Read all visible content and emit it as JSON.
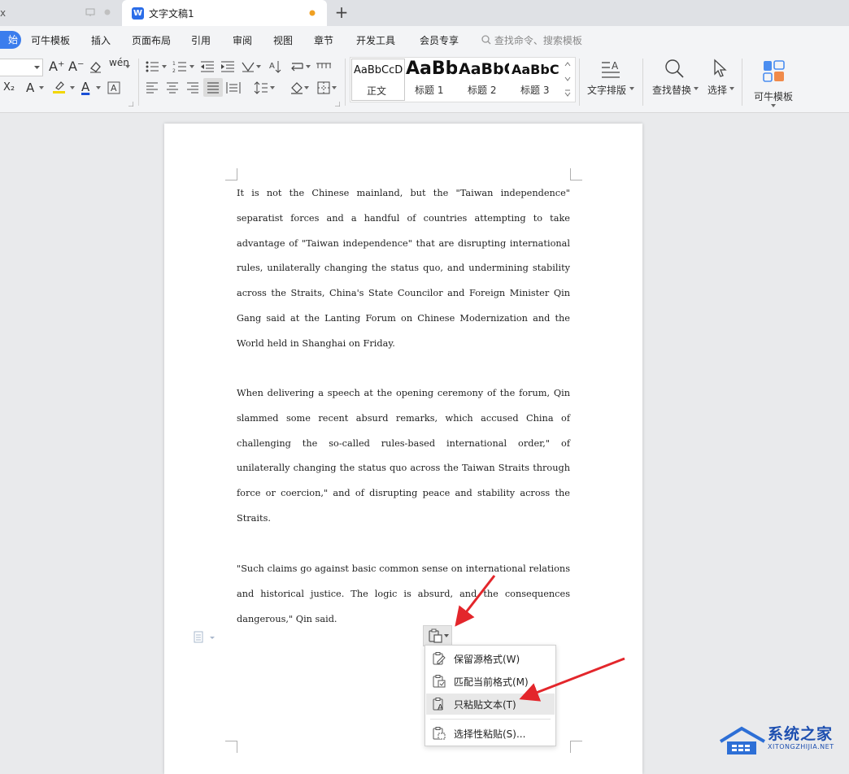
{
  "tabs": [
    {
      "title": "x"
    },
    {
      "title": "文字文稿1"
    }
  ],
  "new_tab": "+",
  "menu": {
    "start": "始",
    "items": [
      "可牛模板",
      "插入",
      "页面布局",
      "引用",
      "审阅",
      "视图",
      "章节",
      "开发工具",
      "会员专享"
    ],
    "search": "查找命令、搜索模板"
  },
  "ribbon": {
    "styles": [
      {
        "sample": "AaBbCcD",
        "name": "正文"
      },
      {
        "sample": "AaBb",
        "name": "标题 1"
      },
      {
        "sample": "AaBbC",
        "name": "标题 2"
      },
      {
        "sample": "AaBbC",
        "name": "标题 3"
      }
    ],
    "text_layout": "文字排版",
    "find_replace": "查找替换",
    "select": "选择",
    "template": "可牛模板",
    "subscript": "X₂"
  },
  "document": {
    "paragraphs": [
      "It is not the Chinese mainland, but the \"Taiwan independence\" separatist forces and a handful of countries attempting to take advantage of \"Taiwan independence\" that are disrupting international rules, unilaterally changing the status quo, and undermining stability across the Straits, China's State Councilor and Foreign Minister Qin Gang said at the Lanting Forum on Chinese Modernization and the World held in Shanghai on Friday.",
      "When delivering a speech at the opening ceremony of the forum, Qin slammed some recent absurd remarks, which accused China of challenging the so-called rules-based international order,\" of unilaterally changing the status quo across the Taiwan Straits through force or coercion,\" and of disrupting peace and stability across the Straits.",
      "\"Such claims go against basic common sense on international relations and historical justice. The logic is absurd, and the consequences dangerous,\" Qin said."
    ]
  },
  "paste_menu": {
    "items": [
      "保留源格式(W)",
      "匹配当前格式(M)",
      "只粘贴文本(T)",
      "选择性粘贴(S)..."
    ],
    "highlighted_index": 2
  },
  "watermark": {
    "title": "系统之家",
    "url": "XITONGZHIJIA.NET"
  },
  "colors": {
    "accent": "#3b7ded",
    "arrow": "#e3262b",
    "squiggle": "#dd2222"
  }
}
